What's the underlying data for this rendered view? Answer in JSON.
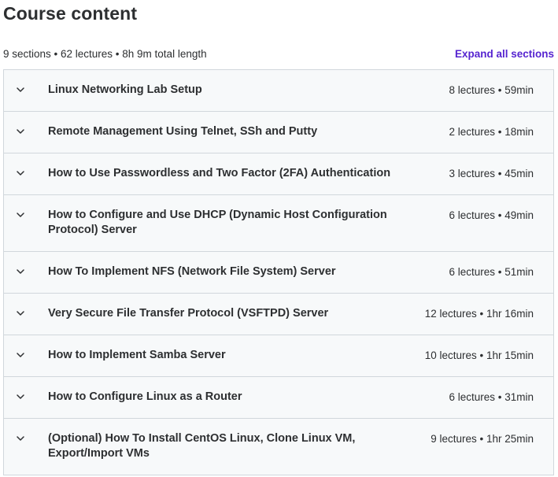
{
  "header": {
    "title": "Course content",
    "summary": "9 sections • 62 lectures • 8h 9m total length",
    "expand_label": "Expand all sections"
  },
  "icons": {
    "chevron": "chevron-down-icon"
  },
  "colors": {
    "accent": "#5624d0",
    "text": "#2d2f31",
    "row_bg": "#f7f9fa",
    "border": "#d1d7dc"
  },
  "sections": [
    {
      "title": "Linux Networking Lab Setup",
      "info": "8 lectures • 59min"
    },
    {
      "title": "Remote Management Using Telnet, SSh and Putty",
      "info": "2 lectures • 18min"
    },
    {
      "title": "How to Use Passwordless and Two Factor (2FA) Authentication",
      "info": "3 lectures • 45min"
    },
    {
      "title": "How to Configure and Use DHCP (Dynamic Host Configuration Protocol) Server",
      "info": "6 lectures • 49min"
    },
    {
      "title": "How To Implement NFS (Network File System) Server",
      "info": "6 lectures • 51min"
    },
    {
      "title": "Very Secure File Transfer Protocol (VSFTPD) Server",
      "info": "12 lectures • 1hr 16min"
    },
    {
      "title": "How to Implement Samba Server",
      "info": "10 lectures • 1hr 15min"
    },
    {
      "title": "How to Configure Linux as a Router",
      "info": "6 lectures • 31min"
    },
    {
      "title": "(Optional) How To Install CentOS Linux, Clone Linux VM, Export/Import VMs",
      "info": "9 lectures • 1hr 25min"
    }
  ]
}
